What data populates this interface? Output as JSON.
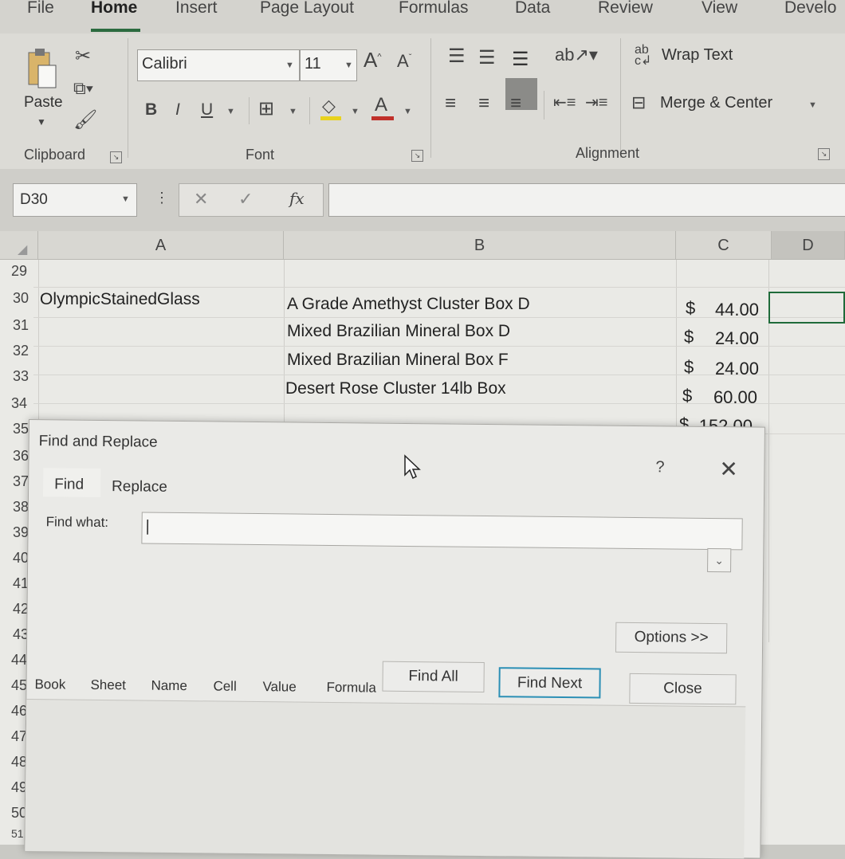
{
  "ribbon_tabs": [
    "File",
    "Home",
    "Insert",
    "Page Layout",
    "Formulas",
    "Data",
    "Review",
    "View",
    "Develo"
  ],
  "active_tab": "Home",
  "clipboard": {
    "paste_label": "Paste",
    "group_label": "Clipboard"
  },
  "font": {
    "name": "Calibri",
    "size": "11",
    "group_label": "Font",
    "grow": "A",
    "shrink": "A",
    "bold": "B",
    "italic": "I",
    "underline": "U",
    "font_color": "A"
  },
  "alignment": {
    "wrap_text": "Wrap Text",
    "merge_center": "Merge & Center",
    "group_label": "Alignment"
  },
  "formula_bar": {
    "name_box": "D30",
    "fx": "fx",
    "value": ""
  },
  "columns": [
    "A",
    "B",
    "C",
    "D"
  ],
  "row_numbers": [
    "29",
    "30",
    "31",
    "32",
    "33",
    "34",
    "35",
    "36",
    "37",
    "38",
    "39",
    "40",
    "41",
    "42",
    "43",
    "44",
    "45",
    "46",
    "47",
    "48",
    "49",
    "50",
    "51"
  ],
  "cells": {
    "a30": "OlympicStainedGlass",
    "b30": "A Grade Amethyst Cluster Box D",
    "b31": "Mixed Brazilian Mineral Box D",
    "b32": "Mixed Brazilian Mineral Box F",
    "b33": "Desert Rose Cluster 14lb Box",
    "c30": "44.00",
    "c31": "24.00",
    "c32": "24.00",
    "c33": "60.00",
    "c34": "152.00",
    "currency": "$"
  },
  "dialog": {
    "title": "Find and Replace",
    "help": "?",
    "close_icon": "✕",
    "tabs": [
      "Find",
      "Replace"
    ],
    "find_label": "Find what:",
    "find_value": "",
    "options_button": "Options >>",
    "find_all_button": "Find All",
    "find_next_button": "Find Next",
    "close_button": "Close",
    "result_columns": [
      "Book",
      "Sheet",
      "Name",
      "Cell",
      "Value",
      "Formula"
    ]
  },
  "colors": {
    "accent_green": "#1f6b3a",
    "focus_blue": "#2b8fb5",
    "font_red": "#c0302a",
    "fill_yellow": "#e8d21e"
  }
}
